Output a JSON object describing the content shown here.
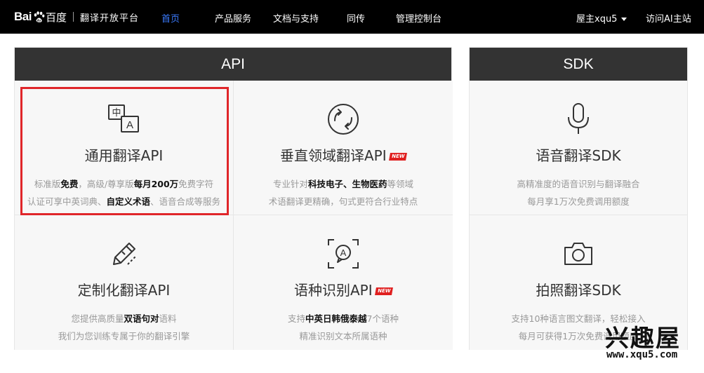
{
  "header": {
    "logo_text": "Bai",
    "logo_du": "百度",
    "logo_subtitle": "翻译开放平台",
    "nav": [
      {
        "label": "首页",
        "active": true
      },
      {
        "label": "产品服务",
        "active": false
      },
      {
        "label": "文档与支持",
        "active": false
      },
      {
        "label": "同传",
        "active": false
      },
      {
        "label": "管理控制台",
        "active": false
      }
    ],
    "user": "屋主xqu5",
    "visit_link": "访问AI主站"
  },
  "api_panel": {
    "title": "API",
    "cards": [
      {
        "title": "通用翻译API",
        "icon": "translate-icon",
        "desc1": [
          "标准版",
          "免费",
          "，高级/尊享版",
          "每月200万",
          "免费字符"
        ],
        "desc2": [
          "认证可享中英词典、",
          "自定义术语",
          "、语音合成等服务"
        ],
        "is_new": false,
        "highlighted": true
      },
      {
        "title": "垂直领域翻译API",
        "icon": "domain-sync-icon",
        "desc1": [
          "专业针对",
          "科技电子、生物医药",
          "等领域"
        ],
        "desc2": [
          "术语翻译更精确，句式更符合行业特点"
        ],
        "is_new": true
      },
      {
        "title": "定制化翻译API",
        "icon": "pencil-edit-icon",
        "desc1": [
          "您提供高质量",
          "双语句对",
          "语料"
        ],
        "desc2": [
          "我们为您训练专属于你的翻译引擎"
        ],
        "is_new": false
      },
      {
        "title": "语种识别API",
        "icon": "language-detect-icon",
        "desc1": [
          "支持",
          "中英日韩俄泰越",
          "7个语种"
        ],
        "desc2": [
          "精准识别文本所属语种"
        ],
        "is_new": true
      }
    ]
  },
  "sdk_panel": {
    "title": "SDK",
    "cards": [
      {
        "title": "语音翻译SDK",
        "icon": "microphone-icon",
        "desc1": "高精准度的语音识别与翻译融合",
        "desc2": "每月享1万次免费调用额度"
      },
      {
        "title": "拍照翻译SDK",
        "icon": "camera-icon",
        "desc1": "支持10种语言图文翻译，轻松接入",
        "desc2": "每月可获得1万次免费调用额度"
      }
    ]
  },
  "badge_new": "NEW",
  "watermark": {
    "title": "兴趣屋",
    "url": "www.xqu5.com"
  },
  "colors": {
    "topbar": "#000000",
    "active_nav": "#3b7cff",
    "panel_header": "#333333",
    "card_bg": "#f7f7f7",
    "highlight": "#e0262a",
    "new_badge": "#e02020"
  }
}
